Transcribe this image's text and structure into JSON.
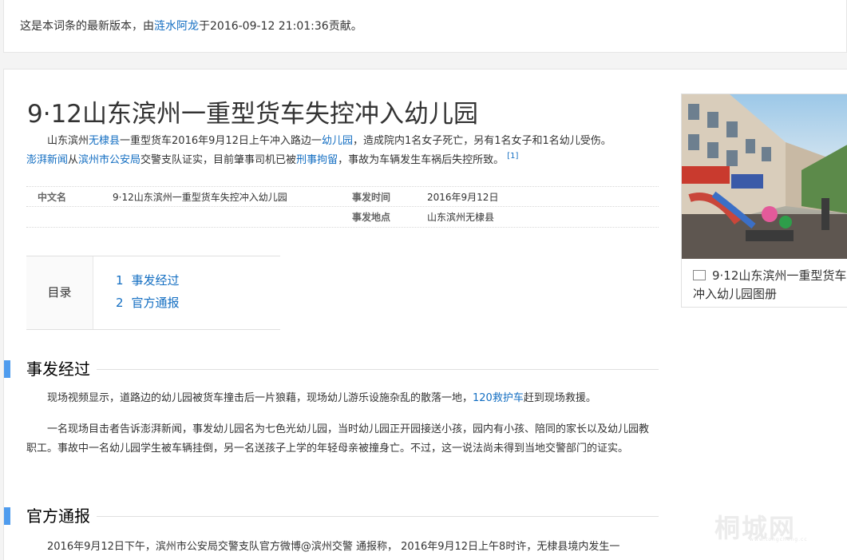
{
  "version_bar": {
    "prefix": "这是本词条的最新版本，由",
    "contributor": "涟水阿龙",
    "suffix": "于2016-09-12 21:01:36贡献。"
  },
  "article": {
    "title": "9·12山东滨州一重型货车失控冲入幼儿园",
    "summary": {
      "t1": "山东滨州",
      "l1": "无棣县",
      "t2": "一重型货车2016年9月12日上午冲入路边一",
      "l2": "幼儿园",
      "t3": "，造成院内1名女子死亡，另有1名女子和1名幼儿受伤。",
      "l3": "澎湃新闻",
      "t4": "从",
      "l4": "滨州市公安局",
      "t5": "交警支队证实，目前肇事司机已被",
      "l5": "刑事拘留",
      "t6": "，事故为车辆发生车祸后失控所致。",
      "ref": "[1]"
    },
    "infobox": [
      {
        "k1": "中文名",
        "v1": "9·12山东滨州一重型货车失控冲入幼儿园",
        "k2": "事发时间",
        "v2": "2016年9月12日"
      },
      {
        "k1": "",
        "v1": "",
        "k2": "事发地点",
        "v2": "山东滨州无棣县"
      }
    ],
    "toc": {
      "title": "目录",
      "items": [
        {
          "num": "1",
          "label": "事发经过"
        },
        {
          "num": "2",
          "label": "官方通报"
        }
      ]
    },
    "sections": [
      {
        "heading": "事发经过",
        "p1_text": "现场视频显示，道路边的幼儿园被货车撞击后一片狼藉，现场幼儿游乐设施杂乱的散落一地，",
        "p1_link": "120救护车",
        "p1_tail": "赶到现场救援。",
        "p2": "一名现场目击者告诉澎湃新闻，事发幼儿园名为七色光幼儿园，当时幼儿园正开园接送小孩，园内有小孩、陪同的家长以及幼儿园教职工。事故中一名幼儿园学生被车辆挂倒，另一名送孩子上学的年轻母亲被撞身亡。不过，这一说法尚未得到当地交警部门的证实。"
      },
      {
        "heading": "官方通报",
        "p1": "2016年9月12日下午，滨州市公安局交警支队官方微博@滨州交警 通报称， 2016年9月12日上午8时许，无棣县境内发生一"
      }
    ]
  },
  "album": {
    "caption": "9·12山东滨州一重型货车冲入幼儿园图册"
  },
  "watermark": {
    "text": "桐城网",
    "sub": "www.tongcheng.cc"
  }
}
